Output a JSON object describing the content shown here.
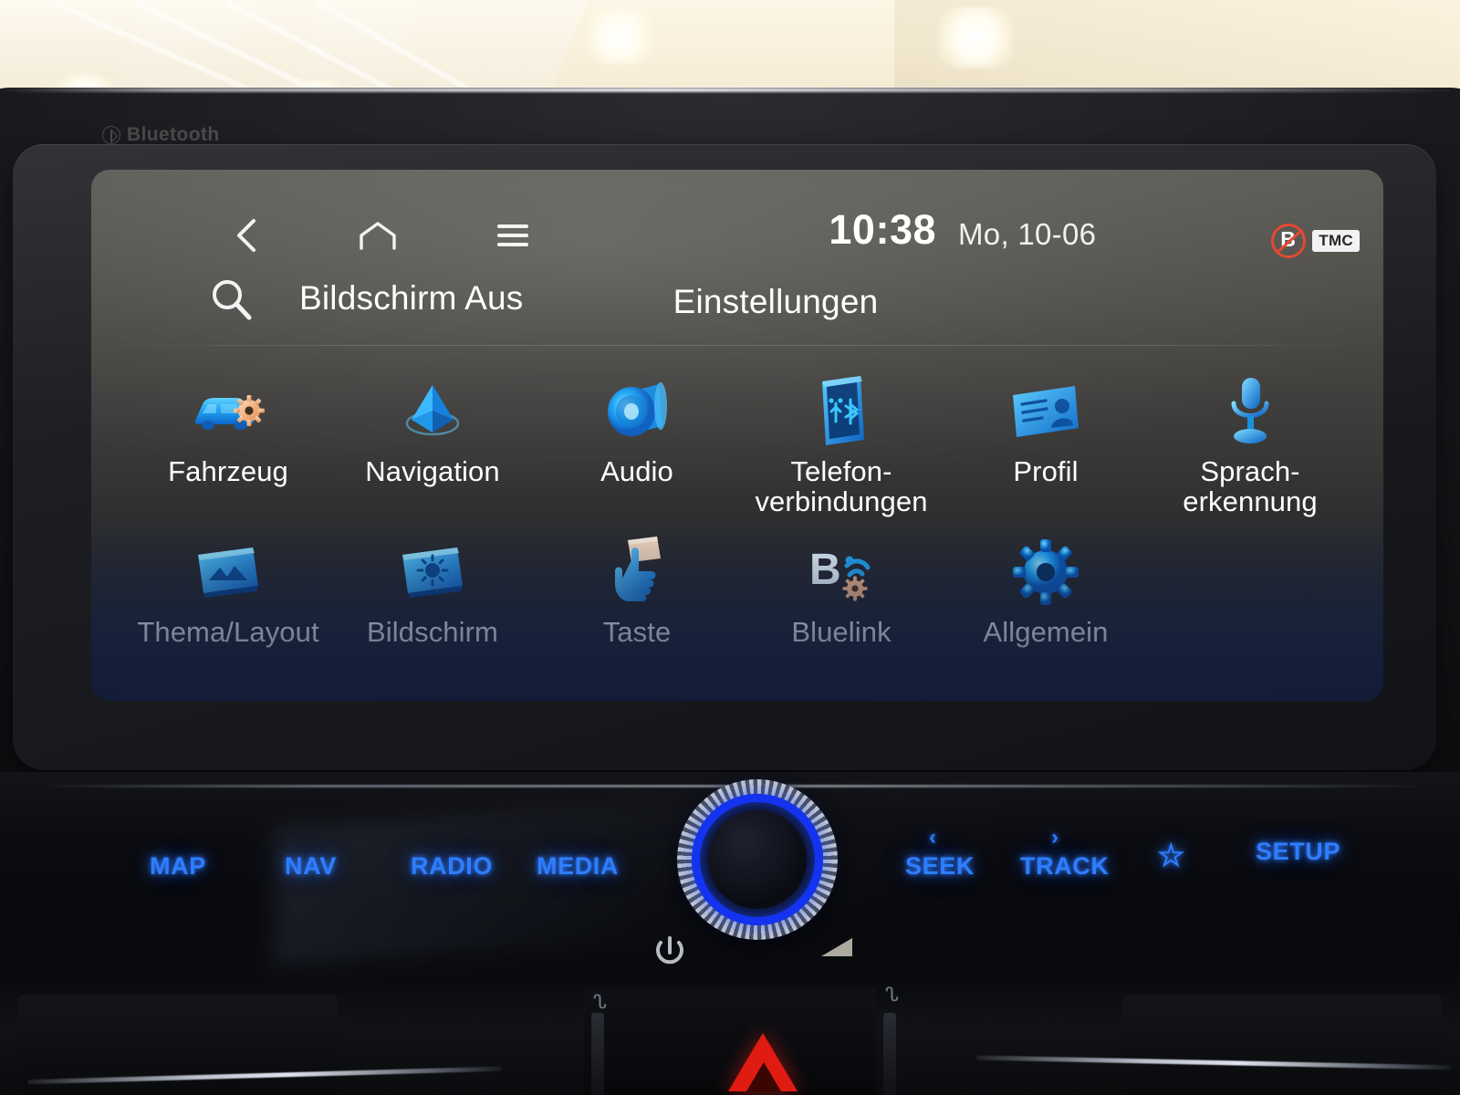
{
  "device": {
    "bezel_logo": "Bluetooth",
    "accent_blue": "#2e7dff",
    "icon_blue": "#1f9bf0",
    "hazard_red": "#e01b12"
  },
  "statusbar": {
    "back_icon": "chevron-left-icon",
    "home_icon": "home-icon",
    "menu_icon": "hamburger-menu-icon",
    "time": "10:38",
    "date": "Mo, 10-06",
    "bluelink_disabled_icon": "bluelink-disabled-icon",
    "tmc_badge": "TMC"
  },
  "header": {
    "search_icon": "search-icon",
    "screen_off_label": "Bildschirm Aus",
    "title": "Einstellungen"
  },
  "menu": {
    "row1": [
      {
        "label": "Fahrzeug",
        "icon": "vehicle-settings-icon"
      },
      {
        "label": "Navigation",
        "icon": "navigation-arrow-icon"
      },
      {
        "label": "Audio",
        "icon": "speaker-icon"
      },
      {
        "label": "Telefon-\nverbindungen",
        "icon": "phone-connections-icon"
      },
      {
        "label": "Profil",
        "icon": "profile-card-icon"
      },
      {
        "label": "Sprach-\nerkennung",
        "icon": "microphone-icon"
      }
    ],
    "row2": [
      {
        "label": "Thema/Layout",
        "icon": "theme-layout-icon"
      },
      {
        "label": "Bildschirm",
        "icon": "display-brightness-icon"
      },
      {
        "label": "Taste",
        "icon": "button-press-icon"
      },
      {
        "label": "Bluelink",
        "icon": "bluelink-icon"
      },
      {
        "label": "Allgemein",
        "icon": "gear-icon"
      }
    ]
  },
  "hardware": {
    "left_buttons": [
      {
        "label": "MAP"
      },
      {
        "label": "NAV"
      },
      {
        "label": "RADIO"
      },
      {
        "label": "MEDIA"
      }
    ],
    "right_buttons": [
      {
        "label": "SEEK",
        "chevron": "‹"
      },
      {
        "label": "TRACK",
        "chevron": "›"
      },
      {
        "label": "SETUP",
        "chevron": ""
      }
    ],
    "favorite_icon": "star-icon",
    "volume_knob": "volume-knob",
    "power_icon": "power-icon",
    "hazard_icon": "hazard-triangle-icon"
  }
}
